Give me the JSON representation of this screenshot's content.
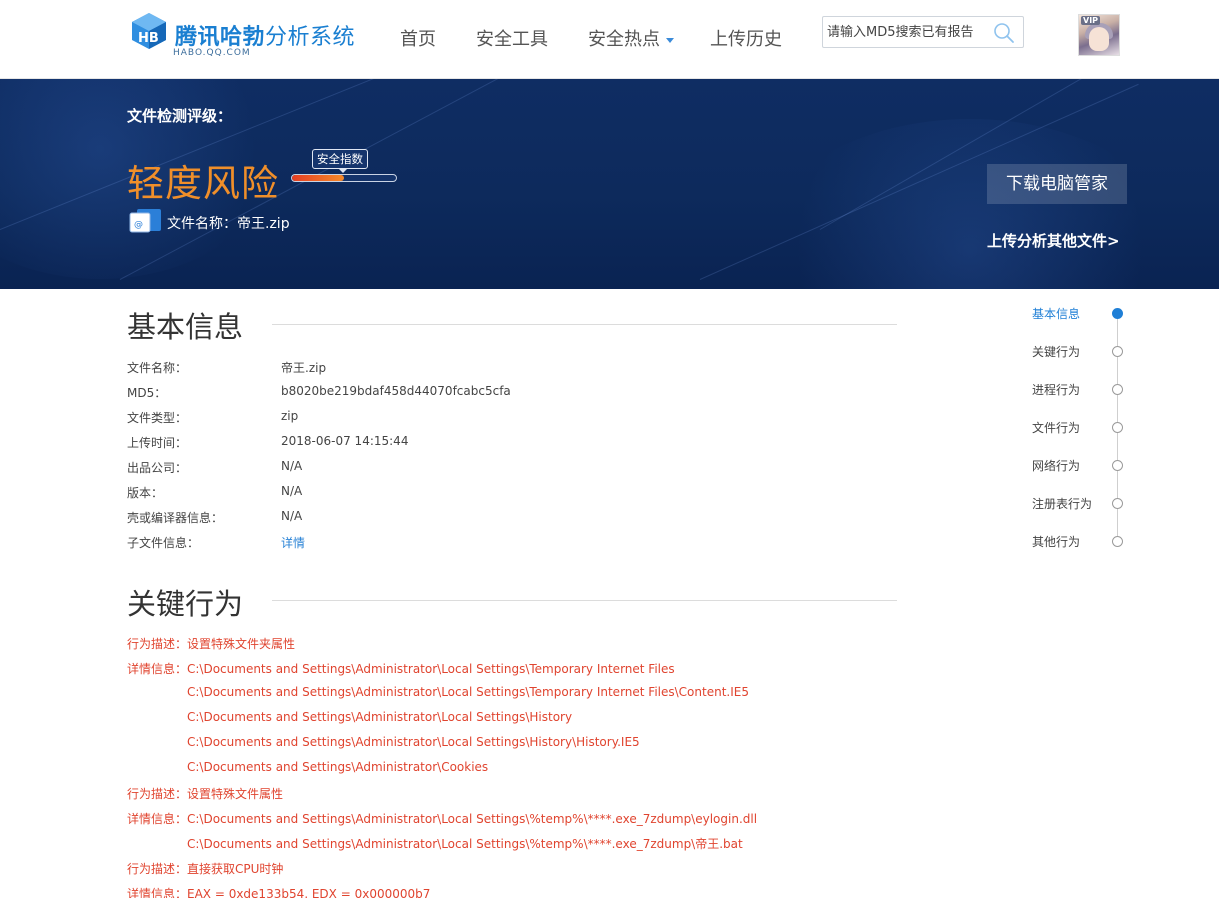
{
  "header": {
    "logo_title_bold": "腾讯哈勃",
    "logo_title_light": "分析系统",
    "logo_subtitle": "HABO.QQ.COM",
    "nav": [
      {
        "label": "首页"
      },
      {
        "label": "安全工具"
      },
      {
        "label": "安全热点"
      },
      {
        "label": "上传历史"
      }
    ],
    "search_placeholder": "请输入MD5搜索已有报告",
    "avatar_badge": "VIP"
  },
  "banner": {
    "rating_label": "文件检测评级：",
    "risk_level": "轻度风险",
    "security_index_label": "安全指数",
    "security_index_fraction": 0.5,
    "file_name_label": "文件名称：",
    "file_name": "帝王.zip",
    "download_button": "下载电脑管家",
    "upload_link": "上传分析其他文件>",
    "colors": {
      "risk": "#f08f2a",
      "banner_bg": "#0f2d63"
    }
  },
  "basic_info": {
    "title": "基本信息",
    "rows": [
      {
        "key": "文件名称：",
        "value": "帝王.zip"
      },
      {
        "key": "MD5：",
        "value": "b8020be219bdaf458d44070fcabc5cfa"
      },
      {
        "key": "文件类型：",
        "value": "zip"
      },
      {
        "key": "上传时间：",
        "value": "2018-06-07 14:15:44"
      },
      {
        "key": "出品公司：",
        "value": "N/A"
      },
      {
        "key": "版本：",
        "value": "N/A"
      },
      {
        "key": "壳或编译器信息：",
        "value": "N/A"
      },
      {
        "key": "子文件信息：",
        "value": "详情"
      }
    ]
  },
  "key_behavior": {
    "title": "关键行为",
    "lines": [
      "行为描述：设置特殊文件夹属性",
      "详情信息：C:\\Documents and Settings\\Administrator\\Local Settings\\Temporary Internet Files",
      "C:\\Documents and Settings\\Administrator\\Local Settings\\Temporary Internet Files\\Content.IE5",
      "C:\\Documents and Settings\\Administrator\\Local Settings\\History",
      "C:\\Documents and Settings\\Administrator\\Local Settings\\History\\History.IE5",
      "C:\\Documents and Settings\\Administrator\\Cookies",
      "行为描述：设置特殊文件属性",
      "详情信息：C:\\Documents and Settings\\Administrator\\Local Settings\\%temp%\\****.exe_7zdump\\eylogin.dll",
      "C:\\Documents and Settings\\Administrator\\Local Settings\\%temp%\\****.exe_7zdump\\帝王.bat",
      "行为描述：直接获取CPU时钟",
      "详情信息：EAX = 0xde133b54, EDX = 0x000000b7"
    ]
  },
  "side_nav": {
    "items": [
      {
        "label": "基本信息",
        "active": true
      },
      {
        "label": "关键行为",
        "active": false
      },
      {
        "label": "进程行为",
        "active": false
      },
      {
        "label": "文件行为",
        "active": false
      },
      {
        "label": "网络行为",
        "active": false
      },
      {
        "label": "注册表行为",
        "active": false
      },
      {
        "label": "其他行为",
        "active": false
      }
    ]
  }
}
